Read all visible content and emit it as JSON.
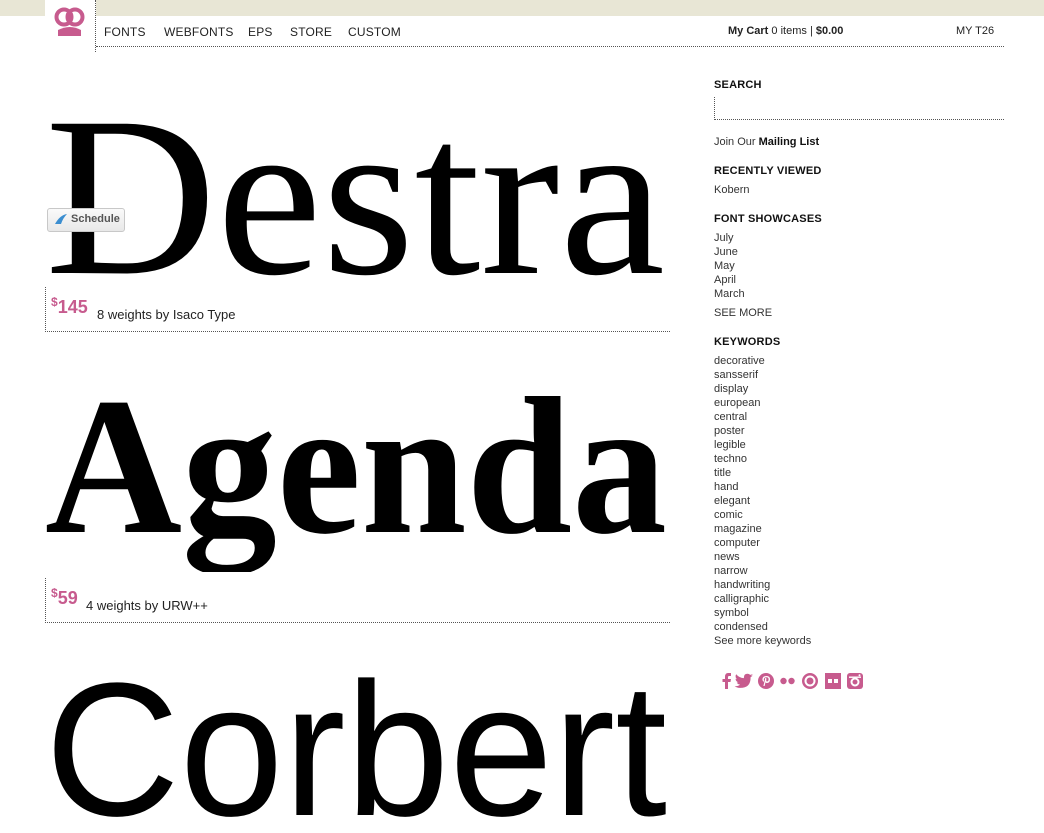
{
  "header": {
    "nav": [
      "FONTS",
      "WEBFONTS",
      "EPS",
      "STORE",
      "CUSTOM"
    ],
    "cart_label": "My Cart",
    "cart_items": "0 items",
    "cart_sep": "|",
    "cart_total": "$0.00",
    "account": "MY T26"
  },
  "fonts": [
    {
      "name": "Destra",
      "currency": "$",
      "price": "145",
      "description": "8 weights by Isaco Type",
      "schedule_label": "Schedule"
    },
    {
      "name": "Agenda",
      "currency": "$",
      "price": "59",
      "description": "4 weights by URW++"
    },
    {
      "name": "Corbert"
    }
  ],
  "sidebar": {
    "search_heading": "SEARCH",
    "mailing_prefix": "Join Our",
    "mailing_link": "Mailing List",
    "recent_heading": "RECENTLY VIEWED",
    "recent": [
      "Kobern"
    ],
    "showcase_heading": "FONT SHOWCASES",
    "showcases": [
      "July",
      "June",
      "May",
      "April",
      "March"
    ],
    "showcase_more": "SEE MORE",
    "keywords_heading": "KEYWORDS",
    "keywords": [
      "decorative",
      "sansserif",
      "display",
      "european",
      "central",
      "poster",
      "legible",
      "techno",
      "title",
      "hand",
      "elegant",
      "comic",
      "magazine",
      "computer",
      "news",
      "narrow",
      "handwriting",
      "calligraphic",
      "symbol",
      "condensed"
    ],
    "keywords_more": "See more keywords",
    "social_icons": [
      "facebook-icon",
      "twitter-icon",
      "pinterest-icon",
      "flickr-icon",
      "dribbble-icon",
      "behance-icon",
      "instagram-icon"
    ]
  },
  "colors": {
    "accent": "#c75b8e",
    "top_band": "#e8e6d5",
    "specimen": "#000000"
  }
}
